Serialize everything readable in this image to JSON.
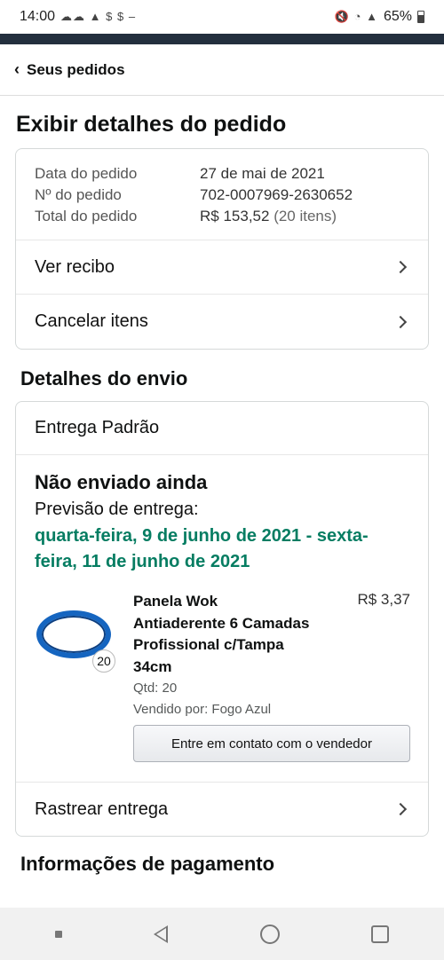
{
  "status_bar": {
    "time": "14:00",
    "notification_icons": "☁☁ ▲ $ $ –",
    "battery": "65%"
  },
  "back_nav": {
    "label": "Seus pedidos"
  },
  "page_title": "Exibir detalhes do pedido",
  "order_summary": {
    "date_label": "Data do pedido",
    "date_value": "27 de mai de 2021",
    "number_label": "Nº do pedido",
    "number_value": "702-0007969-2630652",
    "total_label": "Total do pedido",
    "total_value": "R$ 153,52",
    "total_items": "(20 itens)"
  },
  "order_actions": [
    {
      "label": "Ver recibo"
    },
    {
      "label": "Cancelar itens"
    }
  ],
  "shipping": {
    "section_title": "Detalhes do envio",
    "delivery_type": "Entrega Padrão",
    "status": "Não enviado ainda",
    "forecast_label": "Previsão de entrega:",
    "forecast_date": "quarta-feira, 9 de junho de 2021 - sexta-feira, 11 de junho de 2021",
    "item": {
      "title": "Panela Wok Antiaderente 6 Camadas Profissional c/Tampa 34cm",
      "price": "R$ 3,37",
      "badge_qty": "20",
      "qty": "Qtd: 20",
      "seller": "Vendido por: Fogo Azul",
      "contact_button": "Entre em contato com o vendedor"
    },
    "track_label": "Rastrear entrega"
  },
  "payment_title": "Informações de pagamento",
  "colors": {
    "delivery_green": "#067d62",
    "header_navy": "#232f3e",
    "item_blue": "#1565c0"
  },
  "icons": [
    "chevron-left-icon",
    "chevron-right-icon",
    "nav-back-icon",
    "nav-home-icon",
    "nav-recent-icon"
  ]
}
